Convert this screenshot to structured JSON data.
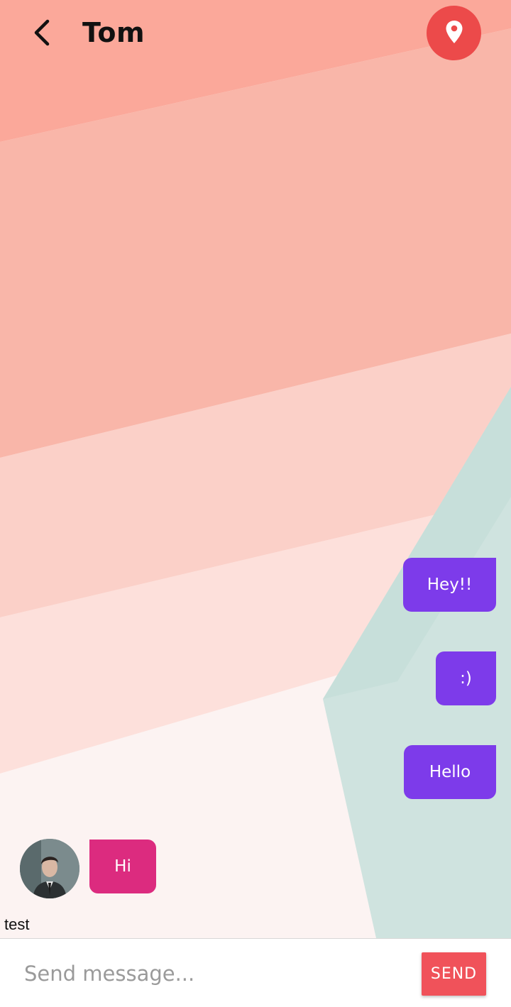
{
  "header": {
    "title": "Tom",
    "back_icon": "chevron-left-icon",
    "location_icon": "map-pin-icon",
    "location_button_color": "#ec4a4a"
  },
  "messages": {
    "outgoing": [
      {
        "text": "Hey!!"
      },
      {
        "text": ":)"
      },
      {
        "text": "Hello"
      }
    ],
    "incoming": [
      {
        "text": "Hi"
      }
    ],
    "outgoing_color": "#7d3bea",
    "incoming_color": "#dc2b7f"
  },
  "sender_label": "test",
  "composer": {
    "placeholder": "Send message...",
    "value": "",
    "send_label": "SEND",
    "send_color": "#f0525a"
  }
}
